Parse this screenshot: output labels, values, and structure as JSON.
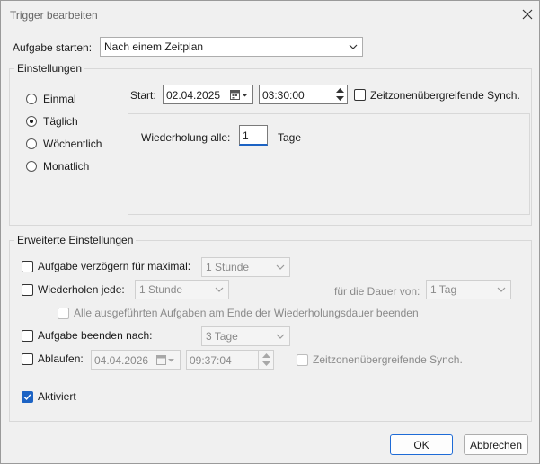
{
  "window": {
    "title": "Trigger bearbeiten",
    "close_icon": "close-icon"
  },
  "start_task": {
    "label": "Aufgabe starten:",
    "value": "Nach einem Zeitplan"
  },
  "settings": {
    "group_label": "Einstellungen",
    "recurrence_options": [
      {
        "label": "Einmal",
        "selected": false
      },
      {
        "label": "Täglich",
        "selected": true
      },
      {
        "label": "Wöchentlich",
        "selected": false
      },
      {
        "label": "Monatlich",
        "selected": false
      }
    ],
    "start_label": "Start:",
    "start_date": "02.04.2025",
    "start_time": "03:30:00",
    "sync_label": "Zeitzonenübergreifende Synch.",
    "sync_checked": false,
    "repeat_label": "Wiederholung alle:",
    "repeat_value": "1",
    "repeat_unit": "Tage"
  },
  "advanced": {
    "group_label": "Erweiterte Einstellungen",
    "delay": {
      "label": "Aufgabe verzögern für maximal:",
      "checked": false,
      "value": "1 Stunde"
    },
    "repeat": {
      "label": "Wiederholen jede:",
      "checked": false,
      "value": "1 Stunde",
      "duration_label": "für die Dauer von:",
      "duration_value": "1 Tag"
    },
    "stop_all": {
      "label": "Alle ausgeführten Aufgaben am Ende der Wiederholungsdauer beenden",
      "checked": false
    },
    "stop_after": {
      "label": "Aufgabe beenden nach:",
      "checked": false,
      "value": "3 Tage"
    },
    "expire": {
      "label": "Ablaufen:",
      "checked": false,
      "date": "04.04.2026",
      "time": "09:37:04",
      "sync_label": "Zeitzonenübergreifende Synch.",
      "sync_checked": false
    },
    "enabled": {
      "label": "Aktiviert",
      "checked": true
    }
  },
  "buttons": {
    "ok": "OK",
    "cancel": "Abbrechen"
  },
  "colors": {
    "accent": "#1c63c4",
    "background": "#f0f0f0",
    "default_button_border": "#1e6bd6"
  }
}
